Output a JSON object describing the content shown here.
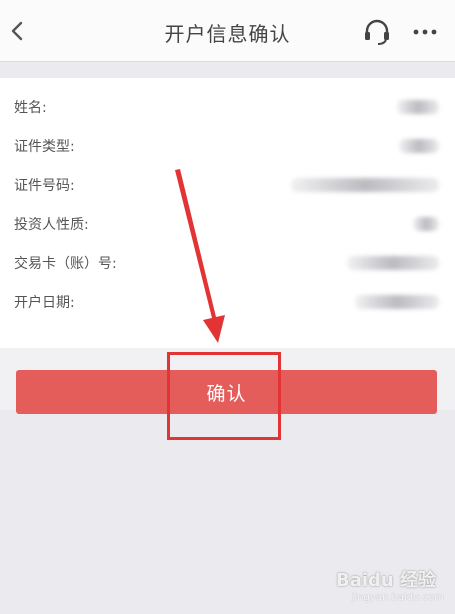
{
  "header": {
    "title": "开户信息确认",
    "back_icon": "chevron-left-icon",
    "service_icon": "headset-icon",
    "more_icon": "more-dots-icon"
  },
  "fields": [
    {
      "label": "姓名:",
      "value": ""
    },
    {
      "label": "证件类型:",
      "value": ""
    },
    {
      "label": "证件号码:",
      "value": ""
    },
    {
      "label": "投资人性质:",
      "value": ""
    },
    {
      "label": "交易卡（账）号:",
      "value": ""
    },
    {
      "label": "开户日期:",
      "value": ""
    }
  ],
  "actions": {
    "confirm_label": "确认"
  },
  "annotation": {
    "arrow_color": "#e23434",
    "box_color": "#e23434"
  },
  "watermark": {
    "logo": "Baidu 经验",
    "sub": "jingyan.baidu.com"
  },
  "colors": {
    "accent": "#e55d5a",
    "background": "#ebebef",
    "header_bg": "#fbfbfb"
  }
}
